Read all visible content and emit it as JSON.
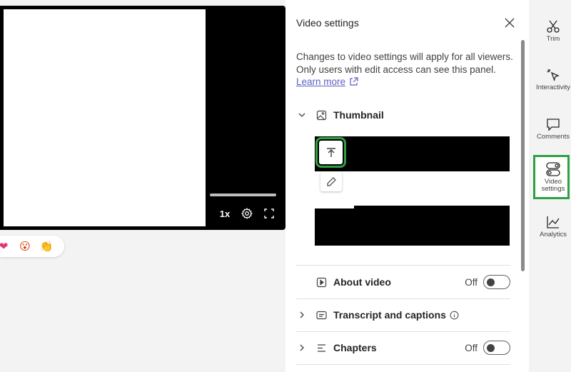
{
  "video": {
    "speed_label": "1x"
  },
  "reactions": [
    {
      "icon": "heart-reaction-icon",
      "glyph": "❤"
    },
    {
      "icon": "surprised-reaction-icon",
      "glyph": "😮"
    },
    {
      "icon": "clap-reaction-icon",
      "glyph": "👏"
    }
  ],
  "panel": {
    "title": "Video settings",
    "description": "Changes to video settings will apply for all viewers. Only users with edit access can see this panel.",
    "learn_more": "Learn more",
    "sections": {
      "thumbnail": {
        "label": "Thumbnail"
      },
      "about_video": {
        "label": "About video",
        "status": "Off"
      },
      "transcript": {
        "label": "Transcript and captions"
      },
      "chapters": {
        "label": "Chapters",
        "status": "Off"
      }
    }
  },
  "rail": {
    "trim": "Trim",
    "interactivity": "Interactivity",
    "comments": "Comments",
    "video_settings": "Video settings",
    "analytics": "Analytics"
  },
  "colors": {
    "accent": "#5b5fc7",
    "highlight": "#2ea043"
  }
}
